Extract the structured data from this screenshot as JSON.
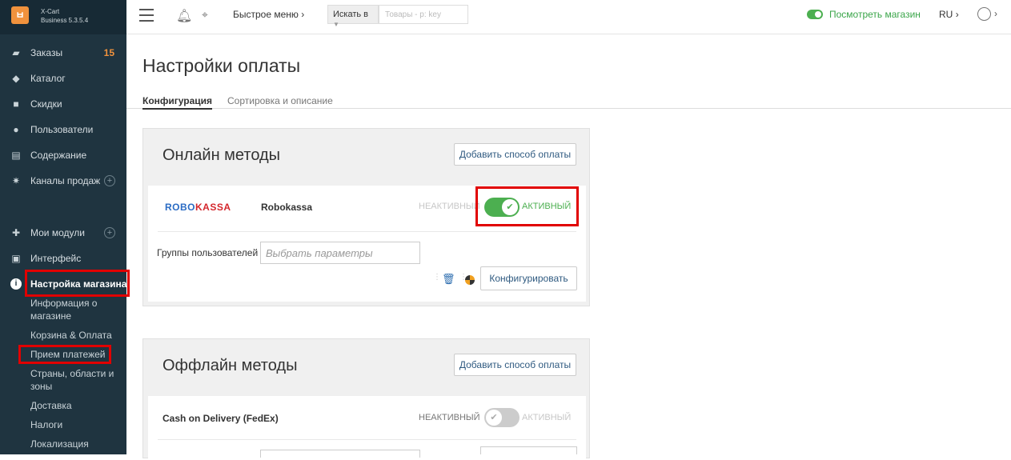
{
  "app": {
    "name_line1": "X-Cart",
    "name_line2": "Business 5.3.5.4",
    "logo_glyph": "ㅂ"
  },
  "sidebar": {
    "items": [
      {
        "label": "Заказы",
        "badge": "15"
      },
      {
        "label": "Каталог"
      },
      {
        "label": "Скидки"
      },
      {
        "label": "Пользователи"
      },
      {
        "label": "Содержание"
      },
      {
        "label": "Каналы продаж"
      },
      {
        "label": "Мои модули"
      },
      {
        "label": "Интерфейс"
      },
      {
        "label": "Настройка магазина"
      }
    ],
    "subitems": [
      "Информация о магазине",
      "Корзина & Оплата",
      "Прием платежей",
      "Страны, области и зоны",
      "Доставка",
      "Налоги",
      "Локализация"
    ]
  },
  "topbar": {
    "quick_menu": "Быстрое меню",
    "search_scope": "Искать в",
    "search_placeholder": "Товары - p: key",
    "view_store": "Посмотреть магазин",
    "lang": "RU"
  },
  "page": {
    "title": "Настройки оплаты",
    "tabs": [
      "Конфигурация",
      "Сортировка и описание"
    ]
  },
  "online": {
    "title": "Онлайн методы",
    "add_button": "Добавить способ оплаты",
    "method": {
      "logo_a": "ROBO",
      "logo_b": "KASSA",
      "name": "Robokassa",
      "inactive_label": "НЕАКТИВНЫЙ",
      "active_label": "АКТИВНЫЙ",
      "groups_label": "Группы пользователей",
      "groups_placeholder": "Выбрать параметры",
      "configure_button": "Конфигурировать"
    }
  },
  "offline": {
    "title": "Оффлайн методы",
    "add_button": "Добавить способ оплаты",
    "method": {
      "name": "Cash on Delivery (FedEx)",
      "inactive_label": "НЕАКТИВНЫЙ",
      "active_label": "АКТИВНЫЙ"
    }
  },
  "colors": {
    "accent_green": "#4caf50",
    "highlight_red": "#e10000",
    "sidebar_bg": "#1f3440"
  }
}
